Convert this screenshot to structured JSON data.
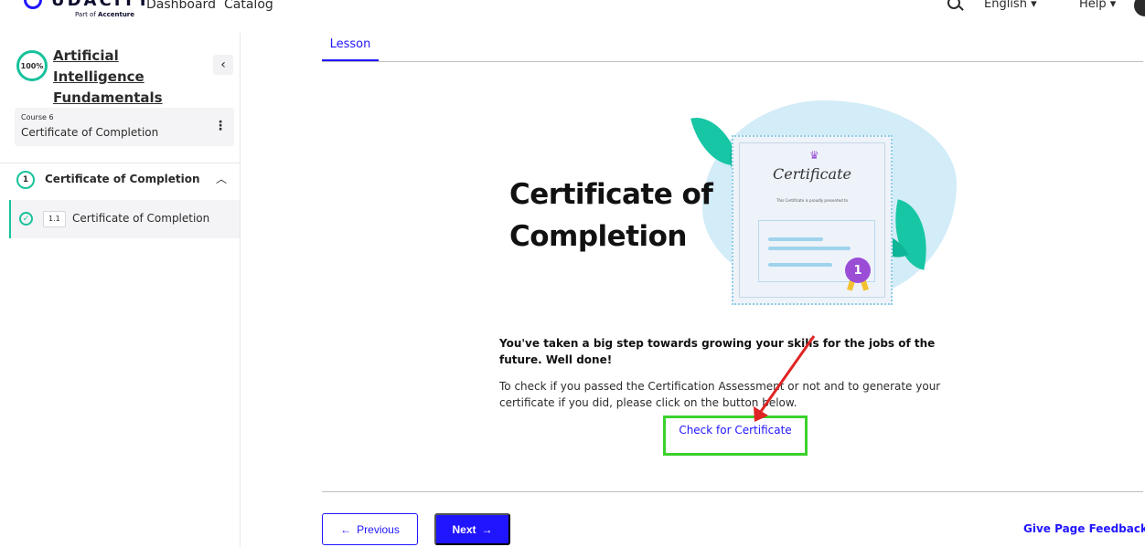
{
  "topnav": {
    "logo_text": "UDACITY",
    "logo_sub_prefix": "Part of",
    "logo_sub_brand": "Accenture",
    "links": [
      "Dashboard",
      "Catalog"
    ],
    "language": "English ▾",
    "help": "Help ▾"
  },
  "sidebar": {
    "progress": "100%",
    "progress_value": 1.0,
    "course_title": "Artificial Intelligence Fundamentals",
    "course_number": "Course 6",
    "course_name": "Certificate of Completion",
    "section": {
      "number": "1",
      "title": "Certificate of Completion"
    },
    "lessons": [
      {
        "number": "1.1",
        "title": "Certificate of Completion",
        "completed": true
      }
    ]
  },
  "main": {
    "tab_label": "Lesson",
    "hero": {
      "title": "Certificate of Completion",
      "certificate_script": "Certificate",
      "certificate_caption": "This Certificate is proudly presented to",
      "medal": "1"
    },
    "message_bold": "You've taken a big step towards growing your skills for the jobs of the future. Well done!",
    "message_body": "To check if you passed the Certification Assessment or not and to generate your certificate if you did, please click on the button below.",
    "check_link": "Check for Certificate",
    "previous_label": "Previous",
    "next_label": "Next",
    "feedback_label": "Give Page Feedback"
  },
  "colors": {
    "accent": "#2015ff",
    "success": "#18c29c",
    "highlight_box": "#3bd12c",
    "annotation_arrow": "#e02424"
  }
}
